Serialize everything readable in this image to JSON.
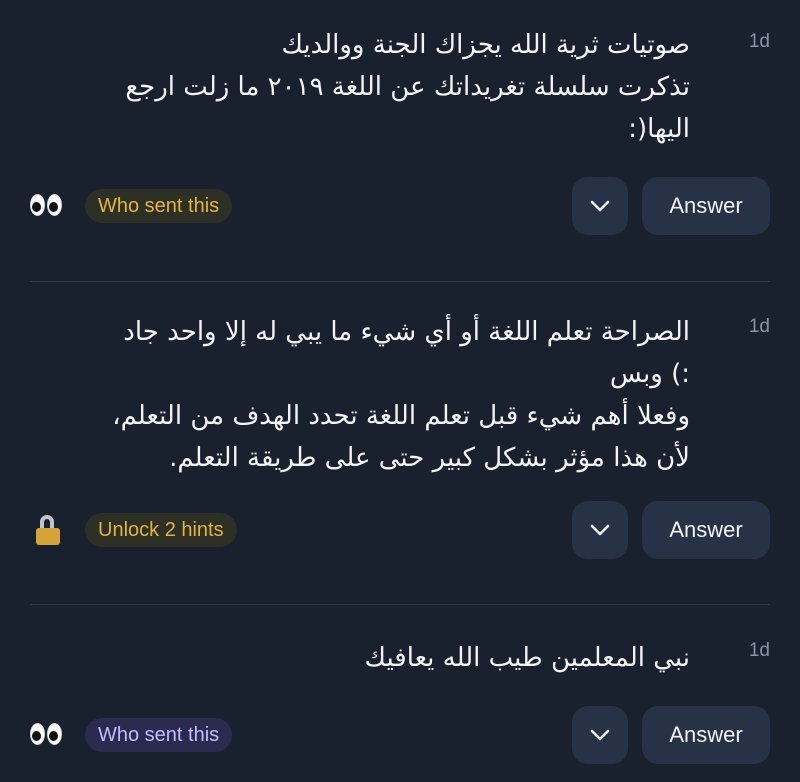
{
  "questions": [
    {
      "text": "صوتيات ثرية الله يجزاك الجنة ووالديك\nتذكرت سلسلة تغريداتك عن اللغة ٢٠١٩ ما زلت ارجع\nاليها(:",
      "time": "1d",
      "emoji_icon": "eyes-emoji-icon",
      "pill_label": "Who sent this",
      "pill_color": "#e3b43f",
      "answer_label": "Answer"
    },
    {
      "text": "الصراحة تعلم اللغة أو أي شيء ما يبي له إلا واحد جاد\n:) وبس\nوفعلا أهم شيء قبل تعلم اللغة تحدد الهدف من التعلم،\nلأن هذا مؤثر بشكل كبير حتى على طريقة التعلم.",
      "time": "1d",
      "emoji_icon": "lock-icon",
      "pill_label": "Unlock 2 hints",
      "pill_color": "#e3b43f",
      "answer_label": "Answer"
    },
    {
      "text": "نبي المعلمين طيب الله يعافيك",
      "time": "1d",
      "emoji_icon": "eyes-emoji-icon",
      "pill_label": "Who sent this",
      "pill_color": "#c6b9ff",
      "answer_label": "Answer"
    }
  ],
  "colors": {
    "background": "#19212e",
    "button": "#283247",
    "divider": "#313a48"
  }
}
